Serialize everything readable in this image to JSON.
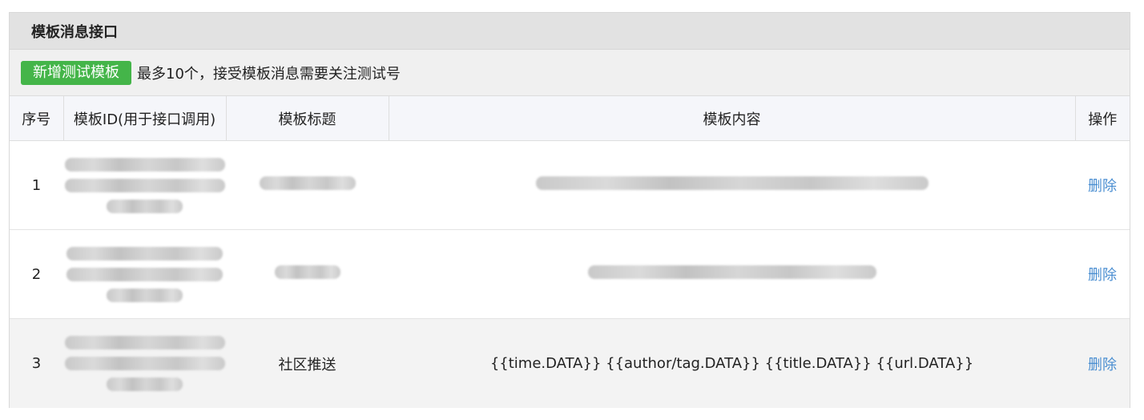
{
  "panel": {
    "title": "模板消息接口"
  },
  "toolbar": {
    "add_button": "新增测试模板",
    "note": "最多10个，接受模板消息需要关注测试号"
  },
  "table": {
    "headers": {
      "index": "序号",
      "template_id": "模板ID(用于接口调用)",
      "title": "模板标题",
      "content": "模板内容",
      "action": "操作"
    },
    "rows": [
      {
        "index": "1",
        "title": "",
        "content": "",
        "action": "删除"
      },
      {
        "index": "2",
        "title": "",
        "content": "",
        "action": "删除"
      },
      {
        "index": "3",
        "title": "社区推送",
        "content": "{{time.DATA}} {{author/tag.DATA}} {{title.DATA}} {{url.DATA}}",
        "action": "删除"
      }
    ]
  }
}
